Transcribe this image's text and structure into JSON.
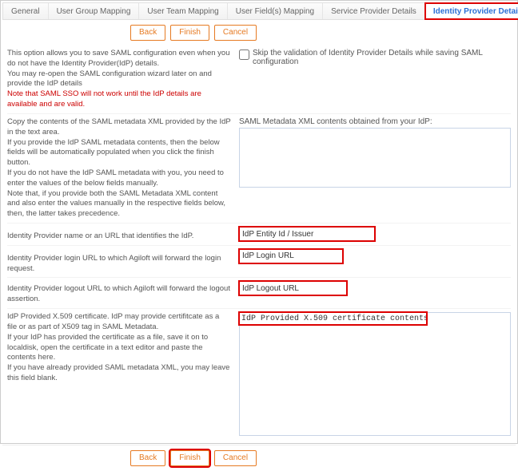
{
  "tabs": {
    "general": "General",
    "userGroup": "User Group Mapping",
    "userTeam": "User Team Mapping",
    "userFields": "User Field(s) Mapping",
    "spDetails": "Service Provider Details",
    "idpDetails": "Identity Provider Details"
  },
  "buttons": {
    "back": "Back",
    "finish": "Finish",
    "cancel": "Cancel"
  },
  "row1": {
    "l1": "This option allows you to save SAML configuration even when you do not have the Identity Provider(IdP) details.",
    "l2": "You may re-open the SAML configuration wizard later on and provide the IdP details",
    "warn": "Note that SAML SSO will not work until the IdP details are available and are valid.",
    "checkbox": "Skip the validation of Identity Provider Details while saving SAML configuration"
  },
  "row2": {
    "l1": "Copy the contents of the SAML metadata XML provided by the IdP in the text area.",
    "l2": "If you provide the IdP SAML metadata contents, then the below fields will be automatically populated when you click the finish button.",
    "l3": "If you do not have the IdP SAML metadata with you, you need to enter the values of the below fields manually.",
    "l4": "Note that, if you provide both the SAML Metadata XML content and also enter the values manually in the respective fields below, then, the latter takes precedence.",
    "label": "SAML Metadata XML contents obtained from your IdP:"
  },
  "row3": {
    "left": "Identity Provider name or an URL that identifies the IdP.",
    "value": "IdP Entity Id / Issuer"
  },
  "row4": {
    "left": "Identity Provider login URL to which Agiloft will forward the login request.",
    "value": "IdP Login URL"
  },
  "row5": {
    "left": "Identity Provider logout URL to which Agiloft will forward the logout assertion.",
    "value": "IdP Logout URL"
  },
  "row6": {
    "l1": "IdP Provided X.509 certificate. IdP may provide certifitcate as a file or as part of X509 tag in SAML Metadata.",
    "l2": "If your IdP has provided the certificate as a file, save it on to localdisk, open the certificate in a text editor and paste the contents here.",
    "l3": "If you have already provided SAML metadata XML, you may leave this field blank.",
    "value": "IdP Provided X.509 certificate contents"
  }
}
